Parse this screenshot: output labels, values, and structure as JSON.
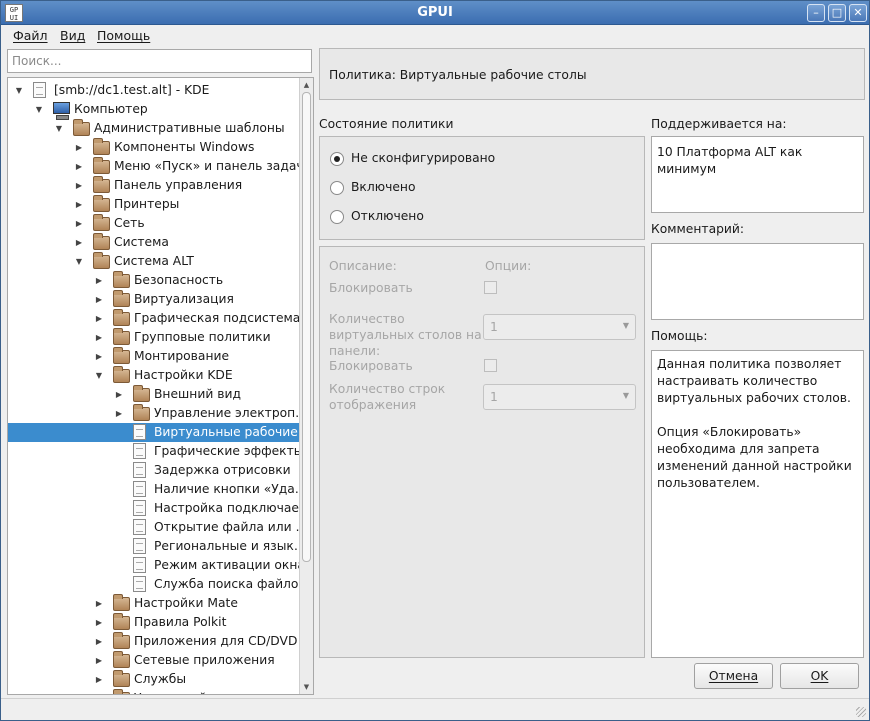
{
  "window": {
    "title": "GPUI",
    "icon_text": "GP\nUI",
    "controls": {
      "minimize": "–",
      "maximize": "□",
      "close": "✕"
    }
  },
  "menu": {
    "file": "Файл",
    "view": "Вид",
    "help": "Помощь"
  },
  "search": {
    "placeholder": "Поиск..."
  },
  "tree": [
    {
      "label": "[smb://dc1.test.alt] - KDE",
      "depth": 0,
      "expander": "open",
      "icon": "doc-icon"
    },
    {
      "label": "Компьютер",
      "depth": 1,
      "expander": "open",
      "icon": "computer-icon"
    },
    {
      "label": "Административные шаблоны",
      "depth": 2,
      "expander": "open",
      "icon": "folder-icon"
    },
    {
      "label": "Компоненты Windows",
      "depth": 3,
      "expander": "closed",
      "icon": "folder-icon"
    },
    {
      "label": "Меню «Пуск» и панель задач",
      "depth": 3,
      "expander": "closed",
      "icon": "folder-icon"
    },
    {
      "label": "Панель управления",
      "depth": 3,
      "expander": "closed",
      "icon": "folder-icon"
    },
    {
      "label": "Принтеры",
      "depth": 3,
      "expander": "closed",
      "icon": "folder-icon"
    },
    {
      "label": "Сеть",
      "depth": 3,
      "expander": "closed",
      "icon": "folder-icon"
    },
    {
      "label": "Система",
      "depth": 3,
      "expander": "closed",
      "icon": "folder-icon"
    },
    {
      "label": "Система ALT",
      "depth": 3,
      "expander": "open",
      "icon": "folder-icon"
    },
    {
      "label": "Безопасность",
      "depth": 4,
      "expander": "closed",
      "icon": "folder-icon"
    },
    {
      "label": "Виртуализация",
      "depth": 4,
      "expander": "closed",
      "icon": "folder-icon"
    },
    {
      "label": "Графическая подсистема",
      "depth": 4,
      "expander": "closed",
      "icon": "folder-icon"
    },
    {
      "label": "Групповые политики",
      "depth": 4,
      "expander": "closed",
      "icon": "folder-icon"
    },
    {
      "label": "Монтирование",
      "depth": 4,
      "expander": "closed",
      "icon": "folder-icon"
    },
    {
      "label": "Настройки KDE",
      "depth": 4,
      "expander": "open",
      "icon": "folder-icon"
    },
    {
      "label": "Внешний вид",
      "depth": 5,
      "expander": "closed",
      "icon": "folder-icon"
    },
    {
      "label": "Управление электроп…",
      "depth": 5,
      "expander": "closed",
      "icon": "folder-icon"
    },
    {
      "label": "Виртуальные рабочие…",
      "depth": 5,
      "expander": "none",
      "icon": "doc-icon",
      "selected": true
    },
    {
      "label": "Графические эффекты",
      "depth": 5,
      "expander": "none",
      "icon": "doc-icon"
    },
    {
      "label": "Задержка отрисовки",
      "depth": 5,
      "expander": "none",
      "icon": "doc-icon"
    },
    {
      "label": "Наличие кнопки «Уда…",
      "depth": 5,
      "expander": "none",
      "icon": "doc-icon"
    },
    {
      "label": "Настройка подключае…",
      "depth": 5,
      "expander": "none",
      "icon": "doc-icon"
    },
    {
      "label": "Открытие файла или …",
      "depth": 5,
      "expander": "none",
      "icon": "doc-icon"
    },
    {
      "label": "Региональные и язык…",
      "depth": 5,
      "expander": "none",
      "icon": "doc-icon"
    },
    {
      "label": "Режим активации окна",
      "depth": 5,
      "expander": "none",
      "icon": "doc-icon"
    },
    {
      "label": "Служба поиска файлов",
      "depth": 5,
      "expander": "none",
      "icon": "doc-icon"
    },
    {
      "label": "Настройки Mate",
      "depth": 4,
      "expander": "closed",
      "icon": "folder-icon"
    },
    {
      "label": "Правила Polkit",
      "depth": 4,
      "expander": "closed",
      "icon": "folder-icon"
    },
    {
      "label": "Приложения для CD/DVD",
      "depth": 4,
      "expander": "closed",
      "icon": "folder-icon"
    },
    {
      "label": "Сетевые приложения",
      "depth": 4,
      "expander": "closed",
      "icon": "folder-icon"
    },
    {
      "label": "Службы",
      "depth": 4,
      "expander": "closed",
      "icon": "folder-icon"
    },
    {
      "label": "Удаленный доступ через …",
      "depth": 4,
      "expander": "closed",
      "icon": "folder-icon"
    }
  ],
  "policy": {
    "title": "Политика: Виртуальные рабочие столы",
    "state_label": "Состояние политики",
    "states": [
      {
        "label": "Не сконфигурировано",
        "checked": true
      },
      {
        "label": "Включено",
        "checked": false
      },
      {
        "label": "Отключено",
        "checked": false
      }
    ],
    "supported_label": "Поддерживается на:",
    "supported_value": "10 Платформа ALT как минимум",
    "comment_label": "Комментарий:",
    "comment_value": "",
    "help_label": "Помощь:",
    "help_text": "Данная политика позволяет настраивать количество виртуальных рабочих столов.\n\nОпция «Блокировать» необходима для запрета изменений данной настройки пользователем."
  },
  "options": {
    "description_header": "Описание:",
    "options_header": "Опции:",
    "block_1": "Блокировать",
    "desktops_label": "Количество виртуальных столов на панели:",
    "desktops_value": "1",
    "block_2": "Блокировать",
    "rows_label": "Количество строк отображения",
    "rows_value": "1"
  },
  "buttons": {
    "cancel": "Отмена",
    "ok": "OK"
  },
  "colors": {
    "selection": "#3b8cce",
    "titlebar": "#4a7cbf"
  }
}
